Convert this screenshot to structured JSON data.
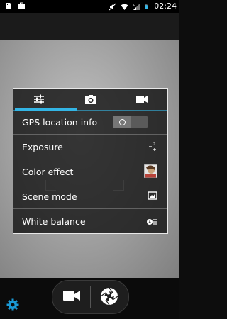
{
  "status_bar": {
    "time": "02:24",
    "icons": [
      "sd-card-icon",
      "briefcase-icon",
      "mute-icon",
      "wifi-icon",
      "signal-icon",
      "battery-icon"
    ]
  },
  "settings_panel": {
    "tabs": [
      {
        "name": "settings-sliders-icon",
        "active": true
      },
      {
        "name": "camera-icon",
        "active": false
      },
      {
        "name": "video-camera-icon",
        "active": false
      }
    ],
    "items": [
      {
        "label": "GPS location info",
        "control": "toggle",
        "value": "off"
      },
      {
        "label": "Exposure",
        "control": "exposure-icon"
      },
      {
        "label": "Color effect",
        "control": "color-effect-thumbnail"
      },
      {
        "label": "Scene mode",
        "control": "scene-icon"
      },
      {
        "label": "White balance",
        "control": "white-balance-auto-icon"
      }
    ]
  },
  "bottom_controls": {
    "settings_icon": "gear-icon",
    "mode_switch": [
      "video-camera-icon",
      "shutter-icon"
    ]
  },
  "colors": {
    "accent": "#33b5e5",
    "panel_bg": "#121212",
    "status_bar": "#000000"
  }
}
